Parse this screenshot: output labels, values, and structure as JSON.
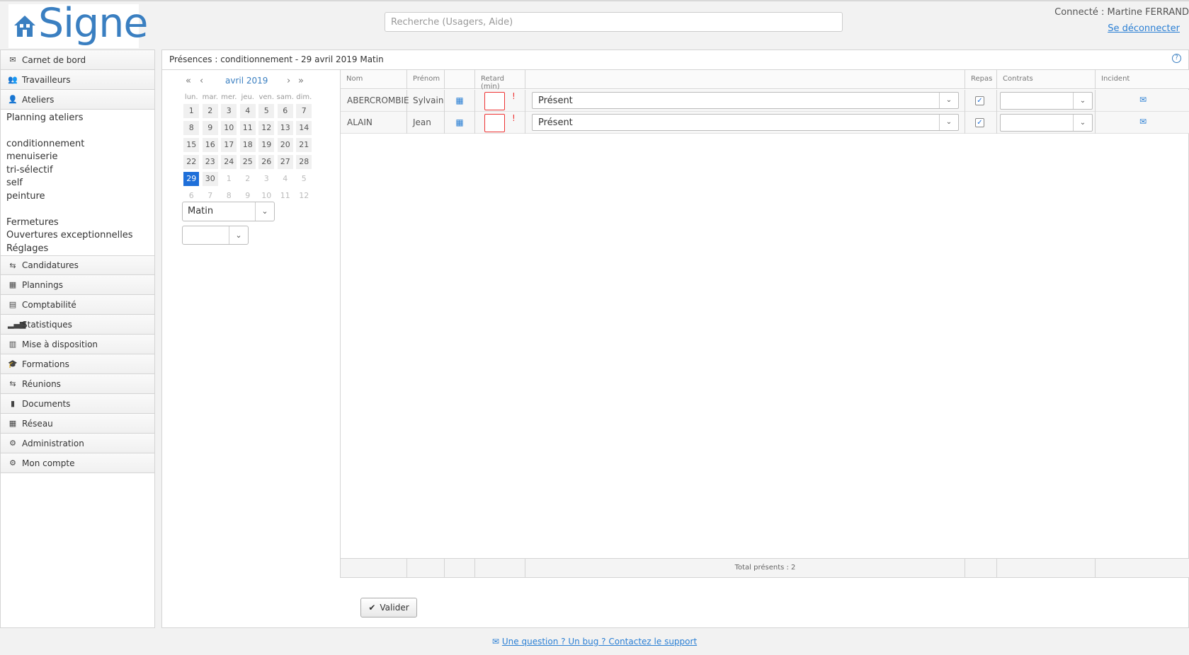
{
  "header": {
    "logo_text": "Signe",
    "search_placeholder": "Recherche (Usagers, Aide)",
    "search_value": "",
    "user_text": "Connecté : Martine FERRAND",
    "logout_label": "Se déconnecter"
  },
  "sidebar": {
    "carnet": "Carnet de bord",
    "travailleurs": "Travailleurs",
    "ateliers": "Ateliers",
    "ateliers_sub": {
      "planning": "Planning ateliers",
      "items": [
        "conditionnement",
        "menuiserie",
        "tri-sélectif",
        "self",
        "peinture"
      ],
      "fermetures": "Fermetures",
      "ouvertures": "Ouvertures exceptionnelles",
      "reglages": "Réglages"
    },
    "candidatures": "Candidatures",
    "plannings": "Plannings",
    "comptabilite": "Comptabilité",
    "statistiques": "Statistiques",
    "mise_a_disposition": "Mise à disposition",
    "formations": "Formations",
    "reunions": "Réunions",
    "documents": "Documents",
    "reseau": "Réseau",
    "administration": "Administration",
    "mon_compte": "Mon compte"
  },
  "main": {
    "title": "Présences : conditionnement - 29 avril 2019 Matin",
    "help_icon": "question-circle-icon"
  },
  "calendar": {
    "month_label": "avril 2019",
    "prev_year": "«",
    "prev_month": "‹",
    "next_month": "›",
    "next_year": "»",
    "weekdays": [
      "lun.",
      "mar.",
      "mer.",
      "jeu.",
      "ven.",
      "sam.",
      "dim."
    ],
    "weeks": [
      [
        "1",
        "2",
        "3",
        "4",
        "5",
        "6",
        "7"
      ],
      [
        "8",
        "9",
        "10",
        "11",
        "12",
        "13",
        "14"
      ],
      [
        "15",
        "16",
        "17",
        "18",
        "19",
        "20",
        "21"
      ],
      [
        "22",
        "23",
        "24",
        "25",
        "26",
        "27",
        "28"
      ],
      [
        "29",
        "30",
        "1",
        "2",
        "3",
        "4",
        "5"
      ],
      [
        "6",
        "7",
        "8",
        "9",
        "10",
        "11",
        "12"
      ]
    ],
    "selected_day": "29",
    "period_value": "Matin",
    "second_select_value": ""
  },
  "table": {
    "headers": {
      "nom": "Nom",
      "prenom": "Prénom",
      "cal": "",
      "retard": "Retard (min)",
      "statut": "",
      "repas": "Repas",
      "contrats": "Contrats",
      "incident": "Incident"
    },
    "rows": [
      {
        "nom": "ABERCROMBIE",
        "prenom": "Sylvain",
        "retard": "",
        "statut": "Présent",
        "repas": true,
        "contrat": ""
      },
      {
        "nom": "ALAIN",
        "prenom": "Jean",
        "retard": "",
        "statut": "Présent",
        "repas": true,
        "contrat": ""
      }
    ],
    "total": "Total présents : 2"
  },
  "actions": {
    "valider": "Valider"
  },
  "footer": {
    "support": "Une question ? Un bug ? Contactez le support"
  },
  "colors": {
    "accent": "#1e6fd9",
    "error": "#ee3333",
    "logo": "#3a7fc1"
  }
}
